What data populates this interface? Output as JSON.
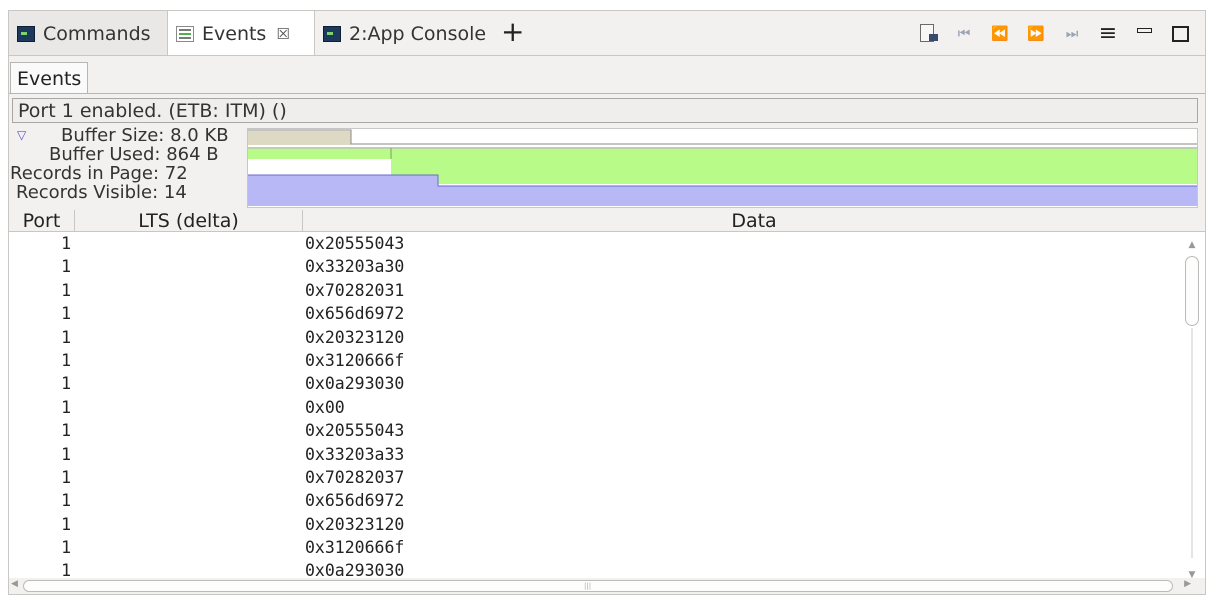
{
  "tabs": [
    {
      "label": "Commands",
      "icon": "console-icon"
    },
    {
      "label": "Events",
      "icon": "events-icon",
      "close": "☒"
    },
    {
      "label": "2:App Console",
      "icon": "console-icon"
    }
  ],
  "add_tab_label": "+",
  "toolbar": {
    "menu_glyph": "≡",
    "first_glyph": "⏮",
    "prev_glyph": "⏪",
    "next_glyph": "⏩",
    "last_glyph": "⏭"
  },
  "subtab": "Events",
  "status": "Port 1 enabled. (ETB: ITM) ()",
  "info": {
    "buffer_size": "Buffer Size: 8.0 KB",
    "buffer_used": "Buffer Used: 864 B",
    "records_in_page": "Records in Page: 72",
    "records_visible": "Records Visible: 14"
  },
  "graph": {
    "size_color": "#ded9c3",
    "used_color": "#b9fb88",
    "page_color": "#b8b8f6"
  },
  "table": {
    "columns": [
      "Port",
      "LTS (delta)",
      "Data"
    ],
    "rows": [
      {
        "port": "1",
        "lts": "",
        "data": "0x20555043"
      },
      {
        "port": "1",
        "lts": "",
        "data": "0x33203a30"
      },
      {
        "port": "1",
        "lts": "",
        "data": "0x70282031"
      },
      {
        "port": "1",
        "lts": "",
        "data": "0x656d6972"
      },
      {
        "port": "1",
        "lts": "",
        "data": "0x20323120"
      },
      {
        "port": "1",
        "lts": "",
        "data": "0x3120666f"
      },
      {
        "port": "1",
        "lts": "",
        "data": "0x0a293030"
      },
      {
        "port": "1",
        "lts": "",
        "data": "0x00"
      },
      {
        "port": "1",
        "lts": "",
        "data": "0x20555043"
      },
      {
        "port": "1",
        "lts": "",
        "data": "0x33203a33"
      },
      {
        "port": "1",
        "lts": "",
        "data": "0x70282037"
      },
      {
        "port": "1",
        "lts": "",
        "data": "0x656d6972"
      },
      {
        "port": "1",
        "lts": "",
        "data": "0x20323120"
      },
      {
        "port": "1",
        "lts": "",
        "data": "0x3120666f"
      },
      {
        "port": "1",
        "lts": "",
        "data": "0x0a293030"
      }
    ]
  }
}
